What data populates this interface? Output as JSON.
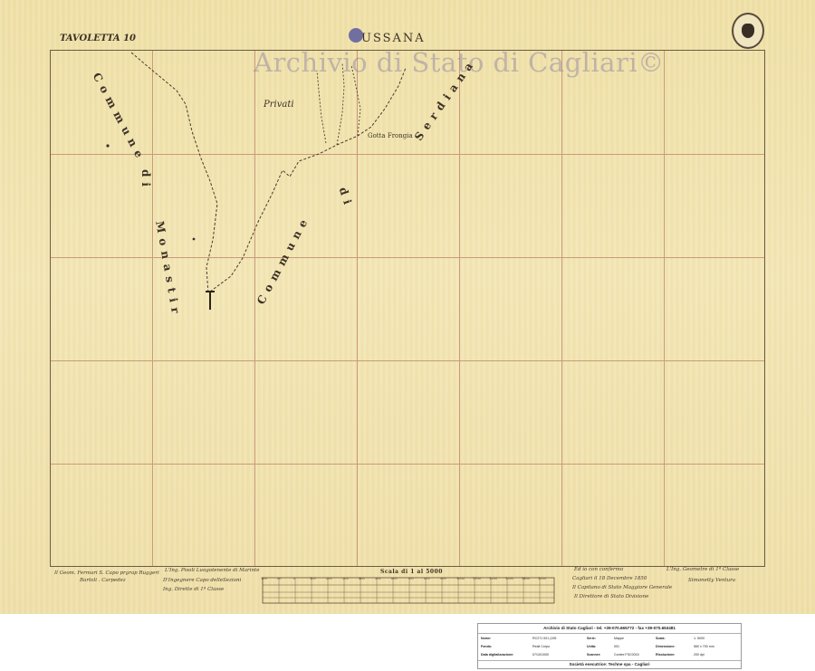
{
  "map": {
    "tavoletta": "TAVOLETTA 10",
    "title": "USSANA",
    "watermark": "Archivio di Stato di Cagliari©",
    "labels": {
      "comune_monastir_1": "Commune",
      "comune_monastir_2": "di",
      "comune_monastir_3": "Monastir",
      "comune_serdiana_1": "Commune",
      "comune_serdiana_2": "di",
      "comune_serdiana_3": "Serdiana",
      "privati": "Privati",
      "gotta": "Gotta Frongia"
    },
    "colors": {
      "paper": "#f0e2ad",
      "grid": "#c99a7c",
      "ink": "#3c3226"
    }
  },
  "scale": {
    "title": "Scala di 1 al 5000",
    "ticks": [
      "100",
      "50",
      "0",
      "100",
      "200",
      "300",
      "400",
      "500",
      "600",
      "700",
      "800",
      "900",
      "1000",
      "1100",
      "1200",
      "1300",
      "1400",
      "1500"
    ]
  },
  "signatures": {
    "left_1": "Il Geom. Fermari S. Capo prgrap Ruggeri",
    "left_2": "Bartoli . Carpedez",
    "mid_1": "L'Ing. Pisoli Luogotenente di Marinte",
    "mid_2": "D'Ingegnere Capo delleSezioni",
    "mid_3": "Ing. Dirette di 1ª Classe",
    "right_1": "Ed io con confermo",
    "right_2": "Cagliari il 18 Decembre 1850",
    "right_3": "Il Capitano di Stato Maggiore Generale",
    "right_4": "Il Direttore di Stato Divisione",
    "right_5": "L'Ing. Geometre di 1ª Classe",
    "right_6": "Simonetty Ventura"
  },
  "info": {
    "header": "Archivio di Stato Cagliari - tel. +39-070.665772 - fax +39-070.653481",
    "rows": [
      [
        {
          "k": "Nome:",
          "v": "RC271 001 (195"
        },
        {
          "k": "Serie:",
          "v": "Mappe"
        },
        {
          "k": "Scala:",
          "v": "1: 5000"
        }
      ],
      [
        {
          "k": "Fondo:",
          "v": "Reali Corpo"
        },
        {
          "k": "Unità:",
          "v": "001"
        },
        {
          "k": "Dimensione:",
          "v": "560 x 700 mm"
        }
      ],
      [
        {
          "k": "Data digitalizzazione:",
          "v": "07/10/1000"
        },
        {
          "k": "Scanner:",
          "v": "Contex FSC0015"
        },
        {
          "k": "Risoluzione:",
          "v": "200 dpi"
        }
      ]
    ],
    "footer": "Società esecutrice: Techne spa - Cagliari"
  }
}
